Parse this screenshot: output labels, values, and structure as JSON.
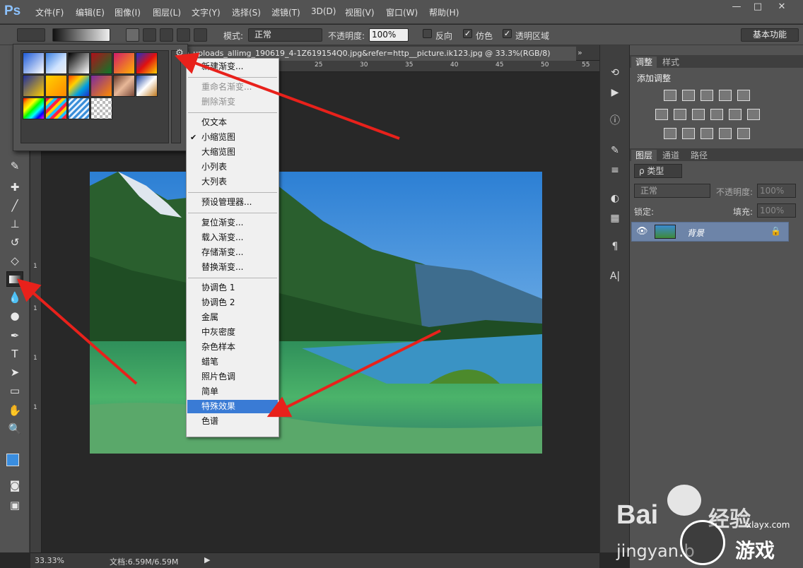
{
  "menubar": {
    "logo": "Ps",
    "items": [
      "文件(F)",
      "编辑(E)",
      "图像(I)",
      "图层(L)",
      "文字(Y)",
      "选择(S)",
      "滤镜(T)",
      "3D(D)",
      "视图(V)",
      "窗口(W)",
      "帮助(H)"
    ],
    "window_controls": [
      "—",
      "□",
      "✕"
    ]
  },
  "options": {
    "mode_label": "模式:",
    "mode_value": "正常",
    "opacity_label": "不透明度:",
    "opacity_value": "100%",
    "reverse_label": "反向",
    "dither_label": "仿色",
    "transparency_label": "透明区域",
    "workspace_button": "基本功能",
    "reverse_checked": false,
    "dither_checked": true,
    "transparency_checked": true
  },
  "document": {
    "tab_title": "m_uploads_allimg_190619_4-1Z619154Q0.jpg&refer=http__picture.ik123.jpg @ 33.3%(RGB/8)",
    "ruler_top": [
      "25",
      "30",
      "35",
      "40",
      "45",
      "50",
      "55"
    ],
    "ruler_left": [
      "1",
      "1",
      "1",
      "1"
    ],
    "zoom": "33.33%",
    "doc_size": "文档:6.59M/6.59M"
  },
  "context_menu": {
    "items": [
      {
        "label": "新建渐变...",
        "disabled": false,
        "checked": false,
        "selected": false
      },
      {
        "sep": true
      },
      {
        "label": "重命名渐变...",
        "disabled": true,
        "checked": false,
        "selected": false
      },
      {
        "label": "删除渐变",
        "disabled": true,
        "checked": false,
        "selected": false
      },
      {
        "sep": true
      },
      {
        "label": "仅文本",
        "disabled": false,
        "checked": false,
        "selected": false
      },
      {
        "label": "小缩览图",
        "disabled": false,
        "checked": true,
        "selected": false
      },
      {
        "label": "大缩览图",
        "disabled": false,
        "checked": false,
        "selected": false
      },
      {
        "label": "小列表",
        "disabled": false,
        "checked": false,
        "selected": false
      },
      {
        "label": "大列表",
        "disabled": false,
        "checked": false,
        "selected": false
      },
      {
        "sep": true
      },
      {
        "label": "预设管理器...",
        "disabled": false,
        "checked": false,
        "selected": false
      },
      {
        "sep": true
      },
      {
        "label": "复位渐变...",
        "disabled": false,
        "checked": false,
        "selected": false
      },
      {
        "label": "载入渐变...",
        "disabled": false,
        "checked": false,
        "selected": false
      },
      {
        "label": "存储渐变...",
        "disabled": false,
        "checked": false,
        "selected": false
      },
      {
        "label": "替换渐变...",
        "disabled": false,
        "checked": false,
        "selected": false
      },
      {
        "sep": true
      },
      {
        "label": "协调色 1",
        "disabled": false,
        "checked": false,
        "selected": false
      },
      {
        "label": "协调色 2",
        "disabled": false,
        "checked": false,
        "selected": false
      },
      {
        "label": "金属",
        "disabled": false,
        "checked": false,
        "selected": false
      },
      {
        "label": "中灰密度",
        "disabled": false,
        "checked": false,
        "selected": false
      },
      {
        "label": "杂色样本",
        "disabled": false,
        "checked": false,
        "selected": false
      },
      {
        "label": "蜡笔",
        "disabled": false,
        "checked": false,
        "selected": false
      },
      {
        "label": "照片色调",
        "disabled": false,
        "checked": false,
        "selected": false
      },
      {
        "label": "简单",
        "disabled": false,
        "checked": false,
        "selected": false
      },
      {
        "label": "特殊效果",
        "disabled": false,
        "checked": false,
        "selected": true
      },
      {
        "label": "色谱",
        "disabled": false,
        "checked": false,
        "selected": false
      }
    ]
  },
  "panels": {
    "adjust_tabs": [
      "调整",
      "样式"
    ],
    "adjust_title": "添加调整",
    "layer_tabs": [
      "图层",
      "通道",
      "路径"
    ],
    "filter_label": "ρ 类型",
    "blend_mode": "正常",
    "opacity_label": "不透明度:",
    "opacity_value": "100%",
    "lock_label": "锁定:",
    "fill_label": "填充:",
    "fill_value": "100%",
    "layer_name": "背景"
  },
  "watermark": {
    "brand": "Bai",
    "brand_suffix": "经验",
    "url": "jingyan.b",
    "site": "xlayx.com",
    "game_text": "游戏"
  },
  "colors": {
    "foreground": "#3a8ee0",
    "background": "#ffffff",
    "arrow": "#e8211b",
    "menu_selected": "#3a7bd5"
  }
}
